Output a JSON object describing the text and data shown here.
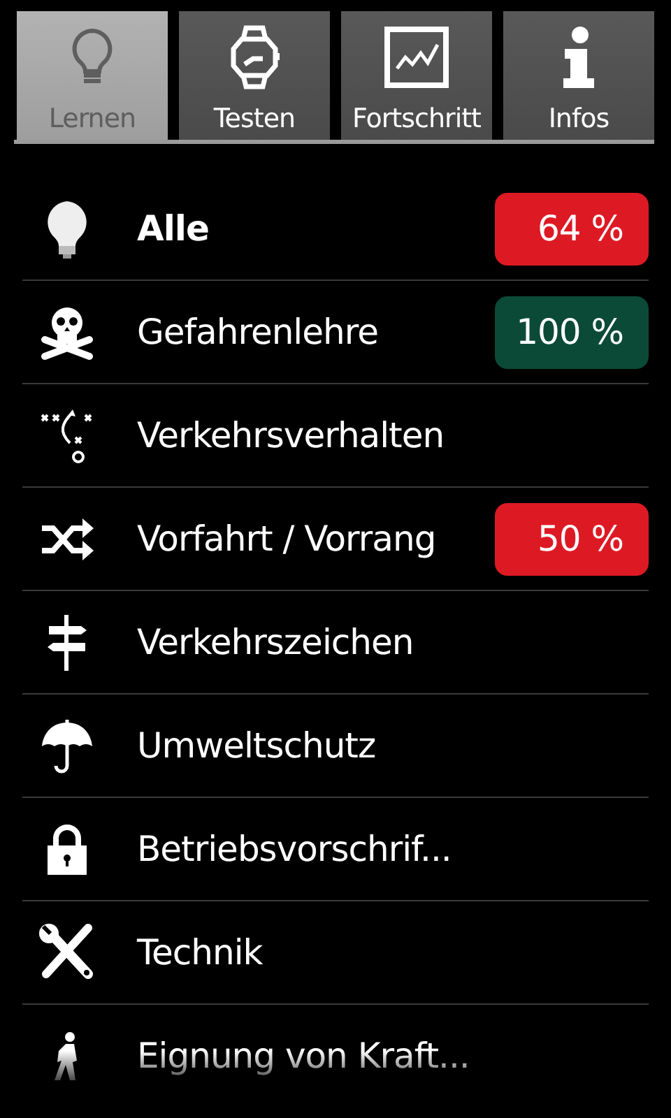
{
  "tabs": [
    {
      "label": "Lernen",
      "selected": true
    },
    {
      "label": "Testen",
      "selected": false
    },
    {
      "label": "Fortschritt",
      "selected": false
    },
    {
      "label": "Infos",
      "selected": false
    }
  ],
  "topics": [
    {
      "kind": "summary",
      "label": "Alle",
      "badge": {
        "text": "64 %",
        "color": "#dd1a24"
      }
    },
    {
      "kind": "topic",
      "label": "Gefahrenlehre",
      "badge": {
        "text": "100 %",
        "color": "#0c4a38"
      }
    },
    {
      "kind": "topic",
      "label": "Verkehrsverhalten"
    },
    {
      "kind": "topic",
      "label": "Vorfahrt / Vorrang",
      "badge": {
        "text": "50 %",
        "color": "#dd1a24"
      }
    },
    {
      "kind": "topic",
      "label": "Verkehrszeichen"
    },
    {
      "kind": "topic",
      "label": "Umweltschutz"
    },
    {
      "kind": "topic",
      "label": "Betriebsvorschrif..."
    },
    {
      "kind": "topic",
      "label": "Technik"
    },
    {
      "kind": "topic",
      "label": "Eignung von Kraft..."
    }
  ]
}
